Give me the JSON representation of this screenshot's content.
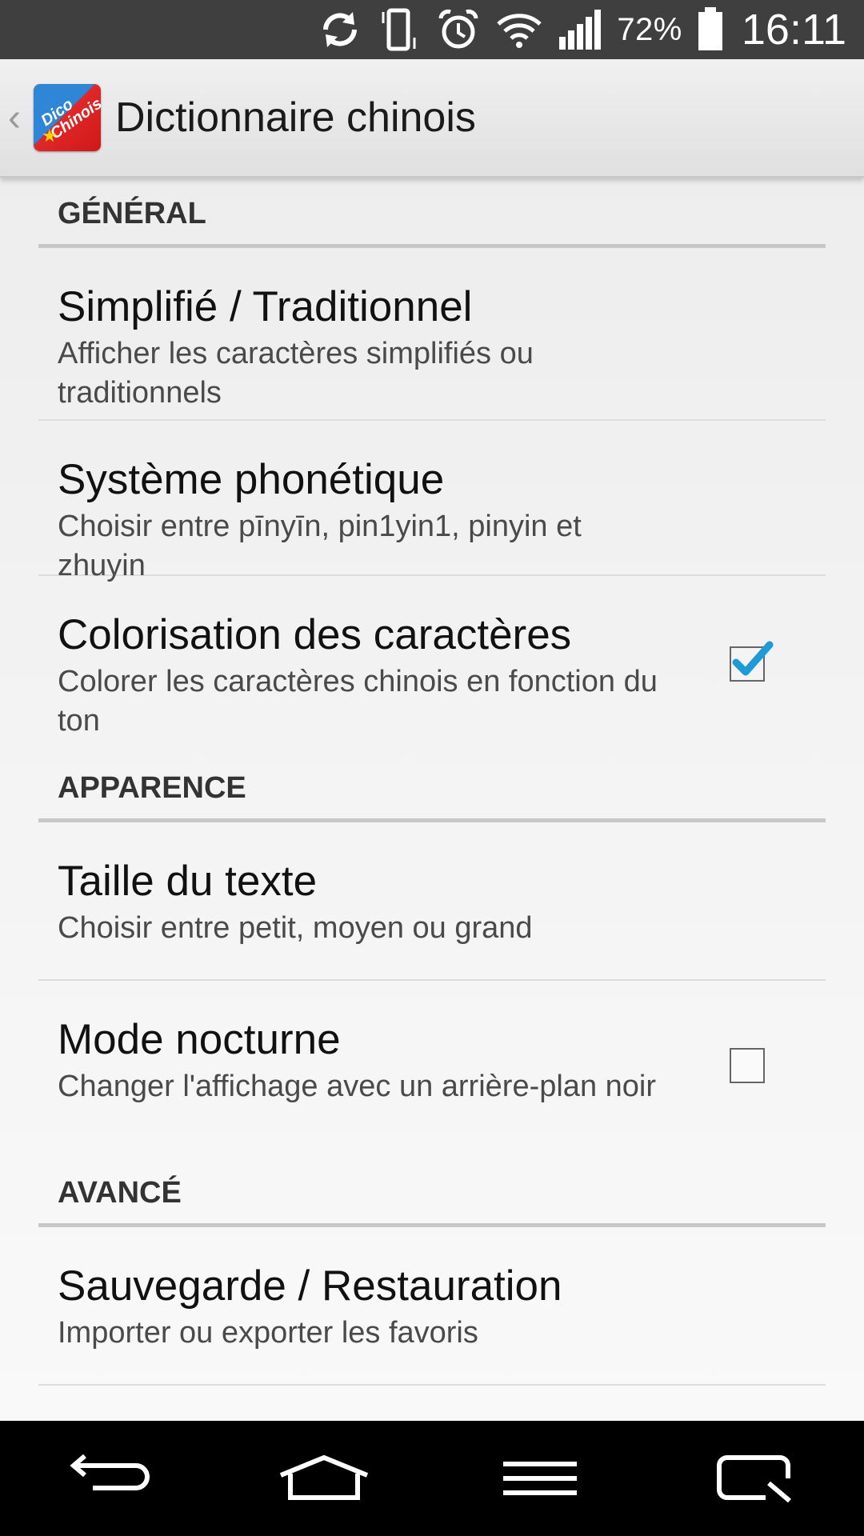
{
  "status_bar": {
    "icons": [
      "sync-icon",
      "vibrate-icon",
      "alarm-icon",
      "wifi-icon",
      "signal-icon"
    ],
    "battery_percent": "72%",
    "time": "16:11"
  },
  "action_bar": {
    "title": "Dictionnaire chinois",
    "app_icon_text": "Dico Chinois"
  },
  "sections": [
    {
      "header": "GÉNÉRAL",
      "items": [
        {
          "title": "Simplifié / Traditionnel",
          "summary": "Afficher les caractères simplifiés ou traditionnels"
        },
        {
          "title": "Système phonétique",
          "summary": "Choisir entre pīnyīn, pin1yin1, pinyin et zhuyin"
        },
        {
          "title": "Colorisation des caractères",
          "summary": "Colorer les caractères chinois en fonction du ton",
          "checked": true
        }
      ]
    },
    {
      "header": "APPARENCE",
      "items": [
        {
          "title": "Taille du texte",
          "summary": "Choisir entre petit, moyen ou grand"
        },
        {
          "title": "Mode nocturne",
          "summary": "Changer l'affichage avec un arrière-plan noir",
          "checked": false
        }
      ]
    },
    {
      "header": "AVANCÉ",
      "items": [
        {
          "title": "Sauvegarde / Restauration",
          "summary": "Importer ou exporter les favoris"
        }
      ]
    }
  ],
  "nav_bar": {
    "buttons": [
      "back-icon",
      "home-icon",
      "menu-icon",
      "recent-apps-icon"
    ]
  },
  "colors": {
    "status_bar_bg": "#3f3f3f",
    "checkbox_check": "#1e9ad6",
    "nav_bar_bg": "#000000"
  }
}
